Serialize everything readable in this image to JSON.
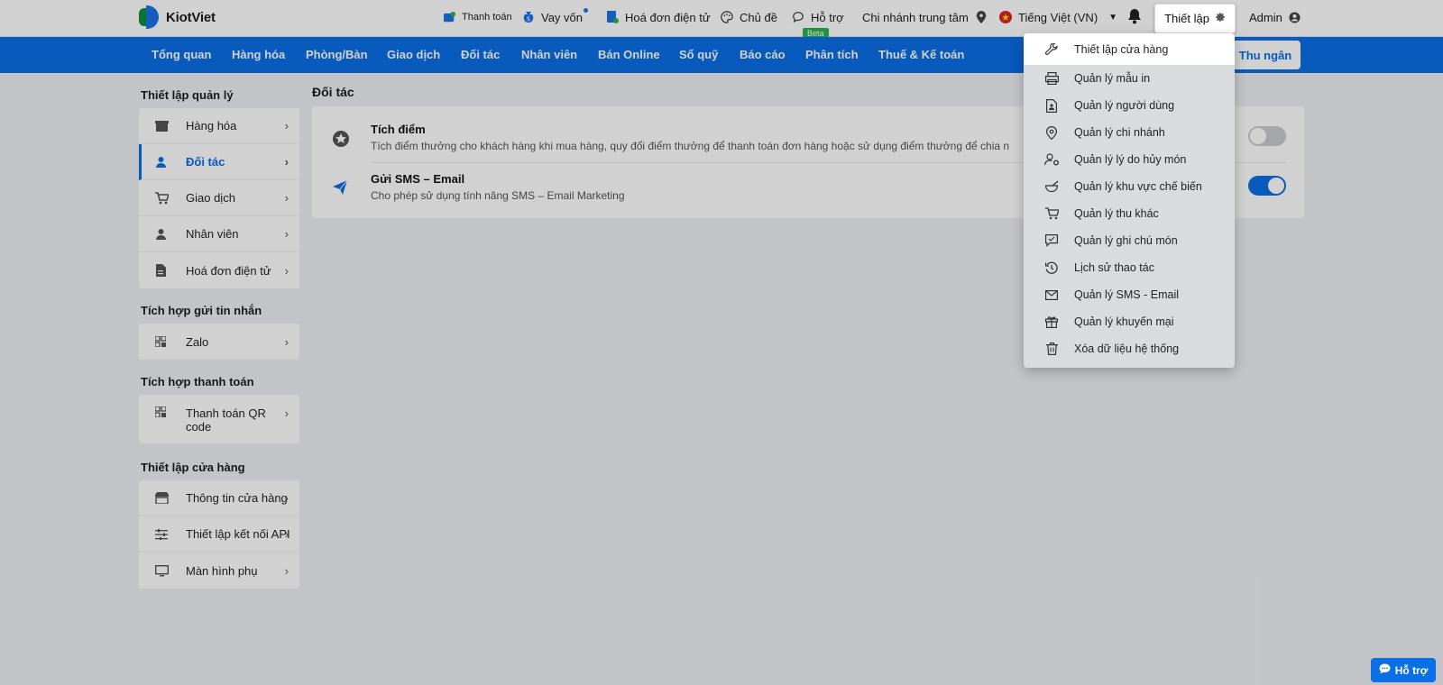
{
  "app": {
    "name": "KiotViet"
  },
  "topbar": {
    "payment": "Thanh toán",
    "loan": "Vay vốn",
    "einvoice": "Hoá đơn điện tử",
    "theme": "Chủ đề",
    "support": "Hỗ trợ",
    "beta": "Beta",
    "branch": "Chi nhánh trung tâm",
    "language": "Tiếng Việt (VN)",
    "setup": "Thiết lập",
    "user": "Admin"
  },
  "mainnav": {
    "items": [
      "Tổng quan",
      "Hàng hóa",
      "Phòng/Bàn",
      "Giao dịch",
      "Đối tác",
      "Nhân viên",
      "Bán Online",
      "Sổ quỹ",
      "Báo cáo",
      "Phân tích",
      "Thuế & Kế toán"
    ],
    "cashier": "Thu ngân"
  },
  "sidebar": {
    "sections": [
      {
        "title": "Thiết lập quản lý",
        "items": [
          "Hàng hóa",
          "Đối tác",
          "Giao dịch",
          "Nhân viên",
          "Hoá đơn điện tử"
        ],
        "active": 1
      },
      {
        "title": "Tích hợp gửi tin nhắn",
        "items": [
          "Zalo"
        ]
      },
      {
        "title": "Tích hợp thanh toán",
        "items": [
          "Thanh toán QR code"
        ]
      },
      {
        "title": "Thiết lập cửa hàng",
        "items": [
          "Thông tin cửa hàng",
          "Thiết lập kết nối API",
          "Màn hình phụ"
        ]
      }
    ]
  },
  "content": {
    "title": "Đối tác",
    "settings": [
      {
        "title": "Tích điểm",
        "desc": "Tích điểm thưởng cho khách hàng khi mua hàng, quy đổi điểm thưởng để thanh toán đơn hàng hoặc sử dụng điểm thưởng để chia n",
        "enabled": false
      },
      {
        "title": "Gửi SMS – Email",
        "desc": "Cho phép sử dụng tính năng SMS – Email Marketing",
        "enabled": true
      }
    ]
  },
  "dropdown": {
    "items": [
      {
        "label": "Thiết lập cửa hàng",
        "icon": "wrench-icon"
      },
      {
        "label": "Quản lý mẫu in",
        "icon": "printer-icon"
      },
      {
        "label": "Quản lý người dùng",
        "icon": "user-doc-icon"
      },
      {
        "label": "Quản lý chi nhánh",
        "icon": "location-icon"
      },
      {
        "label": "Quản lý lý do hủy món",
        "icon": "user-gear-icon"
      },
      {
        "label": "Quản lý khu vực chế biến",
        "icon": "mortar-icon"
      },
      {
        "label": "Quản lý thu khác",
        "icon": "cart-icon"
      },
      {
        "label": "Quản lý ghi chú món",
        "icon": "note-icon"
      },
      {
        "label": "Lịch sử thao tác",
        "icon": "history-icon"
      },
      {
        "label": "Quản lý SMS - Email",
        "icon": "mail-icon"
      },
      {
        "label": "Quản lý khuyến mại",
        "icon": "gift-icon"
      },
      {
        "label": "Xóa dữ liệu hệ thống",
        "icon": "trash-icon"
      }
    ]
  },
  "help_float": "Hỗ trợ",
  "colors": {
    "primary": "#0a6ee6",
    "accent_green": "#2bb14f"
  }
}
